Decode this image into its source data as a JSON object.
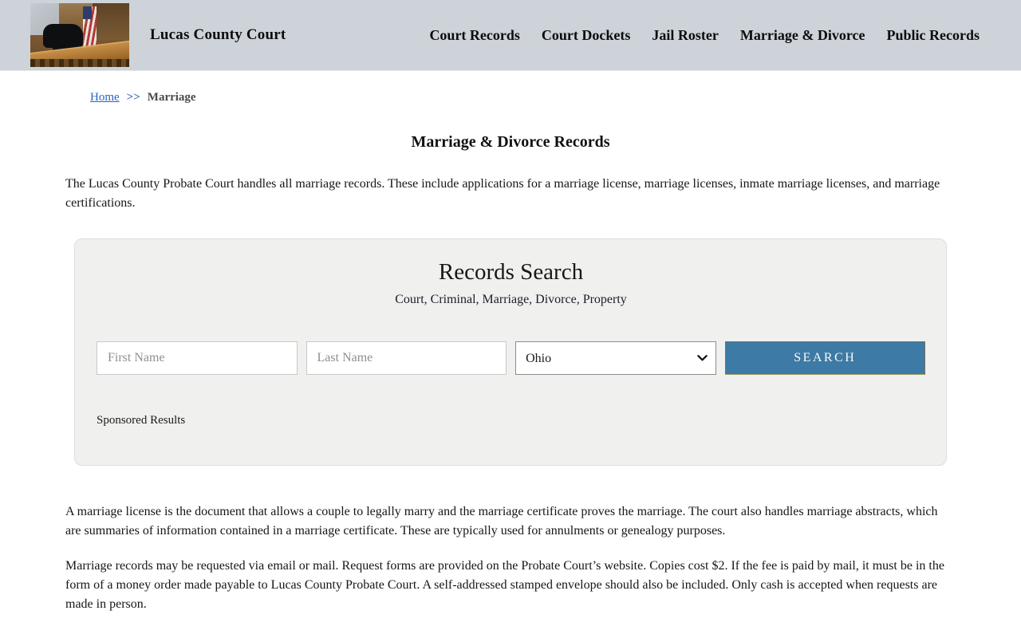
{
  "header": {
    "title": "Lucas County Court",
    "logo": "courtroom-photo",
    "nav": [
      {
        "label": "Court Records"
      },
      {
        "label": "Court Dockets"
      },
      {
        "label": "Jail Roster"
      },
      {
        "label": "Marriage & Divorce"
      },
      {
        "label": "Public Records"
      }
    ]
  },
  "breadcrumb": {
    "home": "Home",
    "separator": ">>",
    "current": "Marriage"
  },
  "page": {
    "title": "Marriage & Divorce Records",
    "paragraphs": [
      "The Lucas County Probate Court handles all marriage records. These include applications for a marriage license, marriage licenses, inmate marriage licenses, and marriage certifications.",
      "A marriage license is the document that allows a couple to legally marry and the marriage certificate proves the marriage. The court also handles marriage abstracts, which are summaries of information contained in a marriage certificate. These are typically used for annulments or genealogy purposes.",
      "Marriage records may be requested via email or mail. Request forms are provided on the Probate Court’s website. Copies cost $2. If the fee is paid by mail, it must be in the form of a money order made payable to Lucas County Probate Court. A self-addressed stamped envelope should also be included. Only cash is accepted when requests are made in person."
    ]
  },
  "search_panel": {
    "title": "Records Search",
    "subtitle": "Court, Criminal, Marriage, Divorce, Property",
    "first_name_placeholder": "First Name",
    "last_name_placeholder": "Last Name",
    "state_selected": "Ohio",
    "search_label": "SEARCH",
    "sponsored_label": "Sponsored Results"
  },
  "colors": {
    "header_background": "#cdd3d9",
    "panel_background": "#f0f0ef",
    "button_blue": "#3d7aa6",
    "link_blue": "#2963c0"
  }
}
